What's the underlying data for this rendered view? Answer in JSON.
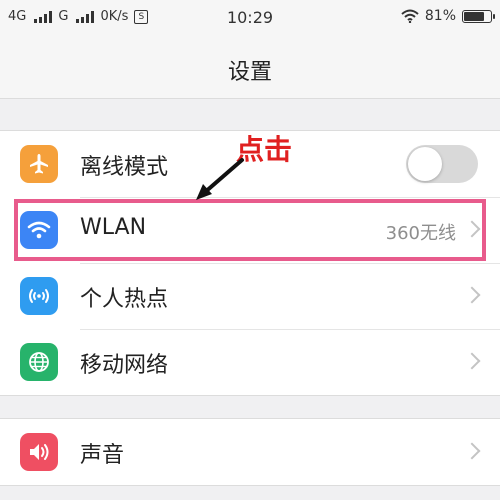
{
  "status_bar": {
    "network_1": "4G",
    "network_2": "G",
    "speed": "0K/s",
    "speed_icon_glyph": "S",
    "time": "10:29",
    "battery_percent": "81%",
    "battery_level": 0.81
  },
  "header": {
    "title": "设置"
  },
  "settings": {
    "airplane": {
      "label": "离线模式",
      "toggle_on": false,
      "icon": "airplane-icon",
      "color": "#f5a03b"
    },
    "wlan": {
      "label": "WLAN",
      "value": "360无线",
      "icon": "wifi-icon",
      "color": "#3c85f5"
    },
    "hotspot": {
      "label": "个人热点",
      "icon": "hotspot-icon",
      "color": "#2f9cf0"
    },
    "mobile_network": {
      "label": "移动网络",
      "icon": "globe-icon",
      "color": "#27b36b"
    },
    "sound": {
      "label": "声音",
      "icon": "speaker-icon",
      "color": "#ef4f62"
    }
  },
  "annotation": {
    "text": "点击",
    "color": "#e02020",
    "highlight_color": "#e85b8c"
  }
}
